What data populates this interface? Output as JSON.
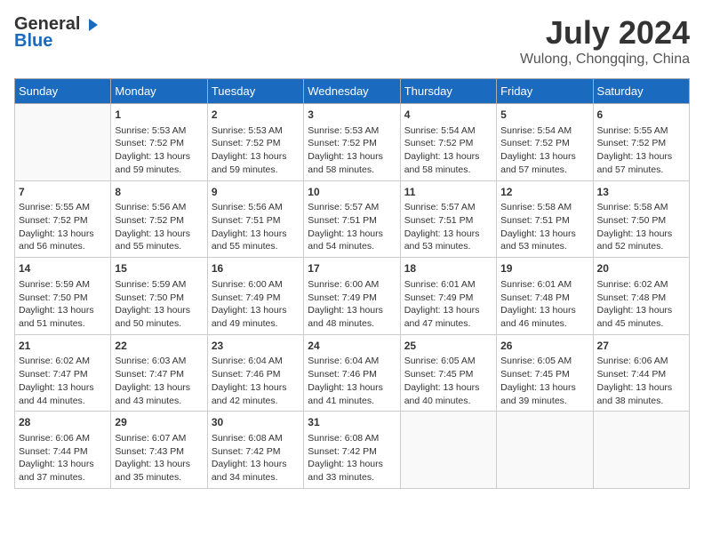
{
  "header": {
    "logo_line1": "General",
    "logo_line2": "Blue",
    "month_year": "July 2024",
    "location": "Wulong, Chongqing, China"
  },
  "days_of_week": [
    "Sunday",
    "Monday",
    "Tuesday",
    "Wednesday",
    "Thursday",
    "Friday",
    "Saturday"
  ],
  "weeks": [
    [
      {
        "day": null
      },
      {
        "day": 1,
        "sunrise": "5:53 AM",
        "sunset": "7:52 PM",
        "daylight": "13 hours and 59 minutes."
      },
      {
        "day": 2,
        "sunrise": "5:53 AM",
        "sunset": "7:52 PM",
        "daylight": "13 hours and 59 minutes."
      },
      {
        "day": 3,
        "sunrise": "5:53 AM",
        "sunset": "7:52 PM",
        "daylight": "13 hours and 58 minutes."
      },
      {
        "day": 4,
        "sunrise": "5:54 AM",
        "sunset": "7:52 PM",
        "daylight": "13 hours and 58 minutes."
      },
      {
        "day": 5,
        "sunrise": "5:54 AM",
        "sunset": "7:52 PM",
        "daylight": "13 hours and 57 minutes."
      },
      {
        "day": 6,
        "sunrise": "5:55 AM",
        "sunset": "7:52 PM",
        "daylight": "13 hours and 57 minutes."
      }
    ],
    [
      {
        "day": 7,
        "sunrise": "5:55 AM",
        "sunset": "7:52 PM",
        "daylight": "13 hours and 56 minutes."
      },
      {
        "day": 8,
        "sunrise": "5:56 AM",
        "sunset": "7:52 PM",
        "daylight": "13 hours and 55 minutes."
      },
      {
        "day": 9,
        "sunrise": "5:56 AM",
        "sunset": "7:51 PM",
        "daylight": "13 hours and 55 minutes."
      },
      {
        "day": 10,
        "sunrise": "5:57 AM",
        "sunset": "7:51 PM",
        "daylight": "13 hours and 54 minutes."
      },
      {
        "day": 11,
        "sunrise": "5:57 AM",
        "sunset": "7:51 PM",
        "daylight": "13 hours and 53 minutes."
      },
      {
        "day": 12,
        "sunrise": "5:58 AM",
        "sunset": "7:51 PM",
        "daylight": "13 hours and 53 minutes."
      },
      {
        "day": 13,
        "sunrise": "5:58 AM",
        "sunset": "7:50 PM",
        "daylight": "13 hours and 52 minutes."
      }
    ],
    [
      {
        "day": 14,
        "sunrise": "5:59 AM",
        "sunset": "7:50 PM",
        "daylight": "13 hours and 51 minutes."
      },
      {
        "day": 15,
        "sunrise": "5:59 AM",
        "sunset": "7:50 PM",
        "daylight": "13 hours and 50 minutes."
      },
      {
        "day": 16,
        "sunrise": "6:00 AM",
        "sunset": "7:49 PM",
        "daylight": "13 hours and 49 minutes."
      },
      {
        "day": 17,
        "sunrise": "6:00 AM",
        "sunset": "7:49 PM",
        "daylight": "13 hours and 48 minutes."
      },
      {
        "day": 18,
        "sunrise": "6:01 AM",
        "sunset": "7:49 PM",
        "daylight": "13 hours and 47 minutes."
      },
      {
        "day": 19,
        "sunrise": "6:01 AM",
        "sunset": "7:48 PM",
        "daylight": "13 hours and 46 minutes."
      },
      {
        "day": 20,
        "sunrise": "6:02 AM",
        "sunset": "7:48 PM",
        "daylight": "13 hours and 45 minutes."
      }
    ],
    [
      {
        "day": 21,
        "sunrise": "6:02 AM",
        "sunset": "7:47 PM",
        "daylight": "13 hours and 44 minutes."
      },
      {
        "day": 22,
        "sunrise": "6:03 AM",
        "sunset": "7:47 PM",
        "daylight": "13 hours and 43 minutes."
      },
      {
        "day": 23,
        "sunrise": "6:04 AM",
        "sunset": "7:46 PM",
        "daylight": "13 hours and 42 minutes."
      },
      {
        "day": 24,
        "sunrise": "6:04 AM",
        "sunset": "7:46 PM",
        "daylight": "13 hours and 41 minutes."
      },
      {
        "day": 25,
        "sunrise": "6:05 AM",
        "sunset": "7:45 PM",
        "daylight": "13 hours and 40 minutes."
      },
      {
        "day": 26,
        "sunrise": "6:05 AM",
        "sunset": "7:45 PM",
        "daylight": "13 hours and 39 minutes."
      },
      {
        "day": 27,
        "sunrise": "6:06 AM",
        "sunset": "7:44 PM",
        "daylight": "13 hours and 38 minutes."
      }
    ],
    [
      {
        "day": 28,
        "sunrise": "6:06 AM",
        "sunset": "7:44 PM",
        "daylight": "13 hours and 37 minutes."
      },
      {
        "day": 29,
        "sunrise": "6:07 AM",
        "sunset": "7:43 PM",
        "daylight": "13 hours and 35 minutes."
      },
      {
        "day": 30,
        "sunrise": "6:08 AM",
        "sunset": "7:42 PM",
        "daylight": "13 hours and 34 minutes."
      },
      {
        "day": 31,
        "sunrise": "6:08 AM",
        "sunset": "7:42 PM",
        "daylight": "13 hours and 33 minutes."
      },
      {
        "day": null
      },
      {
        "day": null
      },
      {
        "day": null
      }
    ]
  ]
}
